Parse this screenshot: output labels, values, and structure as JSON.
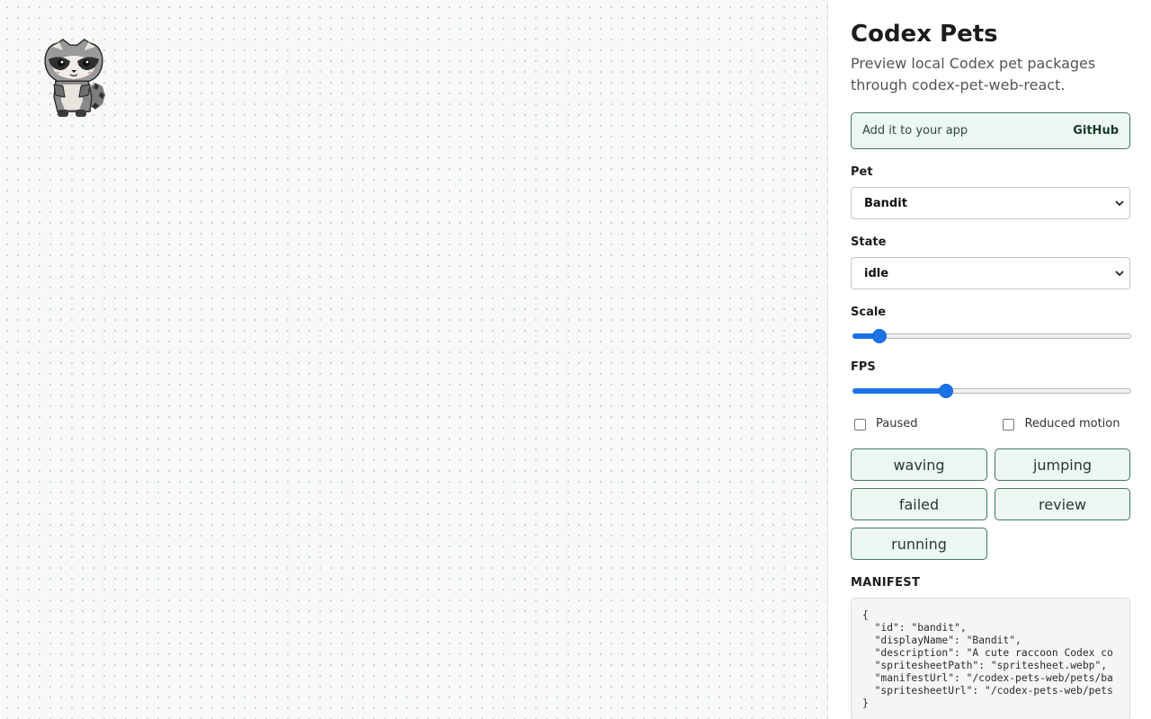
{
  "app": {
    "title": "Codex Pets",
    "subtitle": "Preview local Codex pet packages through codex-pet-web-react."
  },
  "banner": {
    "text": "Add it to your app",
    "link_label": "GitHub"
  },
  "controls": {
    "pet_label": "Pet",
    "pet_value": "Bandit",
    "state_label": "State",
    "state_value": "idle",
    "scale_label": "Scale",
    "scale_level": 0.07,
    "fps_label": "FPS",
    "fps_level": 0.31,
    "paused_label": "Paused",
    "paused_checked": false,
    "reduced_motion_label": "Reduced motion",
    "reduced_motion_checked": false
  },
  "state_buttons": [
    "waving",
    "jumping",
    "failed",
    "review",
    "running"
  ],
  "manifest": {
    "heading": "MANIFEST",
    "lines": [
      "{",
      "  \"id\": \"bandit\",",
      "  \"displayName\": \"Bandit\",",
      "  \"description\": \"A cute raccoon Codex co",
      "  \"spritesheetPath\": \"spritesheet.webp\",",
      "  \"manifestUrl\": \"/codex-pets-web/pets/ba",
      "  \"spritesheetUrl\": \"/codex-pets-web/pets",
      "}"
    ]
  },
  "colors": {
    "accent": "#1a73e8",
    "button_border": "#3f7a60",
    "button_bg": "#eef6f2",
    "stage_bg": "#f6f9f8"
  },
  "icons": {
    "pet_sprite": "raccoon-pet-icon",
    "select_chevron": "chevron-down-icon"
  }
}
